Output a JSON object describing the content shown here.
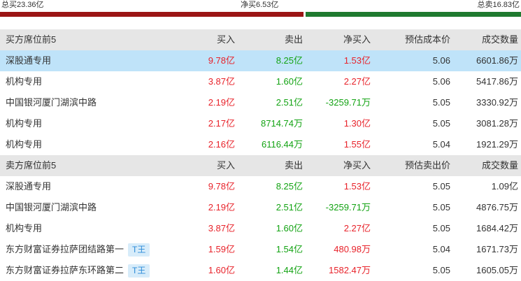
{
  "summary": {
    "total_buy": "总买23.36亿",
    "net_buy": "净买6.53亿",
    "total_sell": "总卖16.83亿"
  },
  "colors": {
    "up": "#e8222a",
    "down": "#13a313",
    "buy_bar": "#9b1515",
    "sell_bar": "#1f7a2f",
    "highlight": "#bfe3f9"
  },
  "buy_section": {
    "headers": {
      "name": "买方席位前5",
      "buy": "买入",
      "sell": "卖出",
      "net": "净买入",
      "price": "预估成本价",
      "volume": "成交数量"
    },
    "rows": [
      {
        "name": "深股通专用",
        "buy": "9.78亿",
        "sell": "8.25亿",
        "net": "1.53亿",
        "price": "5.06",
        "volume": "6601.86万"
      },
      {
        "name": "机构专用",
        "buy": "3.87亿",
        "sell": "1.60亿",
        "net": "2.27亿",
        "price": "5.06",
        "volume": "5417.86万"
      },
      {
        "name": "中国银河厦门湖滨中路",
        "buy": "2.19亿",
        "sell": "2.51亿",
        "net": "-3259.71万",
        "price": "5.05",
        "volume": "3330.92万"
      },
      {
        "name": "机构专用",
        "buy": "2.17亿",
        "sell": "8714.74万",
        "net": "1.30亿",
        "price": "5.05",
        "volume": "3081.28万"
      },
      {
        "name": "机构专用",
        "buy": "2.16亿",
        "sell": "6116.44万",
        "net": "1.55亿",
        "price": "5.04",
        "volume": "1921.29万"
      }
    ]
  },
  "sell_section": {
    "headers": {
      "name": "卖方席位前5",
      "buy": "买入",
      "sell": "卖出",
      "net": "净买入",
      "price": "预估卖出价",
      "volume": "成交数量"
    },
    "rows": [
      {
        "name": "深股通专用",
        "buy": "9.78亿",
        "sell": "8.25亿",
        "net": "1.53亿",
        "price": "5.05",
        "volume": "1.09亿"
      },
      {
        "name": "中国银河厦门湖滨中路",
        "buy": "2.19亿",
        "sell": "2.51亿",
        "net": "-3259.71万",
        "price": "5.05",
        "volume": "4876.75万"
      },
      {
        "name": "机构专用",
        "buy": "3.87亿",
        "sell": "1.60亿",
        "net": "2.27亿",
        "price": "5.05",
        "volume": "1684.42万"
      },
      {
        "name": "东方财富证券拉萨团结路第一",
        "tag": "T王",
        "buy": "1.59亿",
        "sell": "1.54亿",
        "net": "480.98万",
        "price": "5.04",
        "volume": "1671.73万"
      },
      {
        "name": "东方财富证券拉萨东环路第二",
        "tag": "T王",
        "buy": "1.60亿",
        "sell": "1.44亿",
        "net": "1582.47万",
        "price": "5.05",
        "volume": "1605.05万"
      }
    ]
  }
}
